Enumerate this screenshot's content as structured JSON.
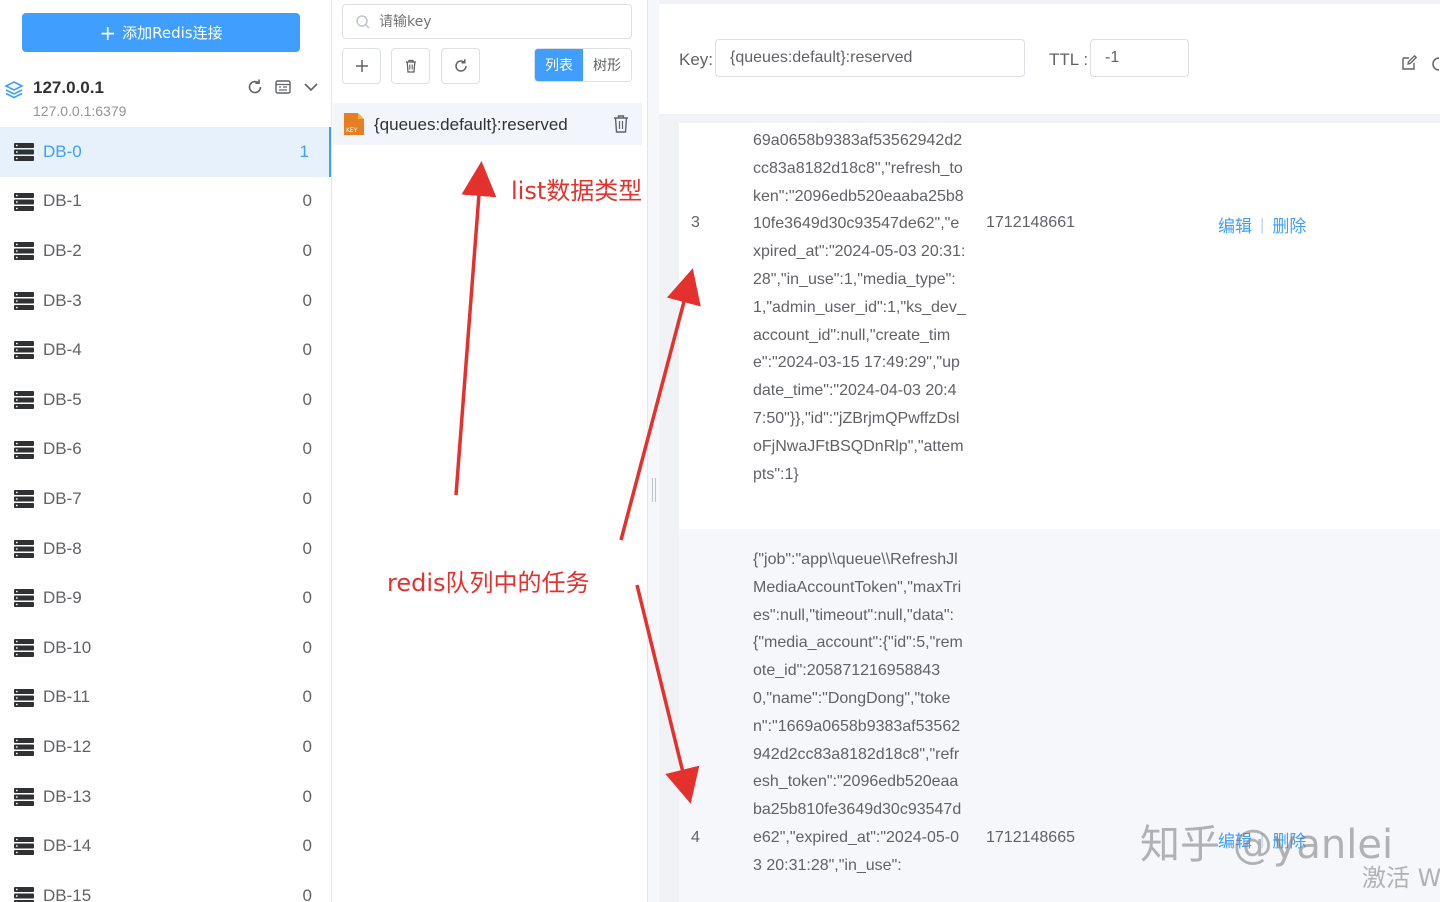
{
  "sidebar": {
    "add_button": "添加Redis连接",
    "connection": {
      "name": "127.0.0.1",
      "address": "127.0.0.1:6379"
    },
    "databases": [
      {
        "label": "DB-0",
        "count": "1",
        "active": true
      },
      {
        "label": "DB-1",
        "count": "0"
      },
      {
        "label": "DB-2",
        "count": "0"
      },
      {
        "label": "DB-3",
        "count": "0"
      },
      {
        "label": "DB-4",
        "count": "0"
      },
      {
        "label": "DB-5",
        "count": "0"
      },
      {
        "label": "DB-6",
        "count": "0"
      },
      {
        "label": "DB-7",
        "count": "0"
      },
      {
        "label": "DB-8",
        "count": "0"
      },
      {
        "label": "DB-9",
        "count": "0"
      },
      {
        "label": "DB-10",
        "count": "0"
      },
      {
        "label": "DB-11",
        "count": "0"
      },
      {
        "label": "DB-12",
        "count": "0"
      },
      {
        "label": "DB-13",
        "count": "0"
      },
      {
        "label": "DB-14",
        "count": "0"
      },
      {
        "label": "DB-15",
        "count": "0"
      }
    ]
  },
  "keys": {
    "search_placeholder": "请输key",
    "view_list": "列表",
    "view_tree": "树形",
    "key_badge": "KEY",
    "items": [
      "{queues:default}:reserved"
    ]
  },
  "detail": {
    "key_label": "Key:",
    "key_value": "{queues:default}:reserved",
    "ttl_label": "TTL :",
    "ttl_value": "-1",
    "rows": [
      {
        "index": "3",
        "value": "69a0658b9383af53562942d2cc83a8182d18c8\",\"refresh_token\":\"2096edb520eaaba25b810fe3649d30c93547de62\",\"expired_at\":\"2024-05-03 20:31:28\",\"in_use\":1,\"media_type\":1,\"admin_user_id\":1,\"ks_dev_account_id\":null,\"create_time\":\"2024-03-15 17:49:29\",\"update_time\":\"2024-04-03 20:47:50\"}},\"id\":\"jZBrjmQPwffzDsloFjNwaJFtBSQDnRlp\",\"attempts\":1}",
        "score": "1712148661",
        "edit": "编辑",
        "delete": "删除"
      },
      {
        "index": "4",
        "value": "{\"job\":\"app\\\\queue\\\\RefreshJlMediaAccountToken\",\"maxTries\":null,\"timeout\":null,\"data\":{\"media_account\":{\"id\":5,\"remote_id\":2058712169588430,\"name\":\"DongDong\",\"token\":\"1669a0658b9383af53562942d2cc83a8182d18c8\",\"refresh_token\":\"2096edb520eaaba25b810fe3649d30c93547de62\",\"expired_at\":\"2024-05-03 20:31:28\",\"in_use\":",
        "score": "1712148665",
        "edit": "编辑",
        "delete": "删除"
      }
    ]
  },
  "annotations": {
    "list_type": "list数据类型",
    "queue_tasks": "redis队列中的任务",
    "color": "#e5312e"
  },
  "watermark": "知乎 @yanlei",
  "activate": "激活 W",
  "colors": {
    "primary": "#409eff",
    "annotation": "#e5312e"
  }
}
